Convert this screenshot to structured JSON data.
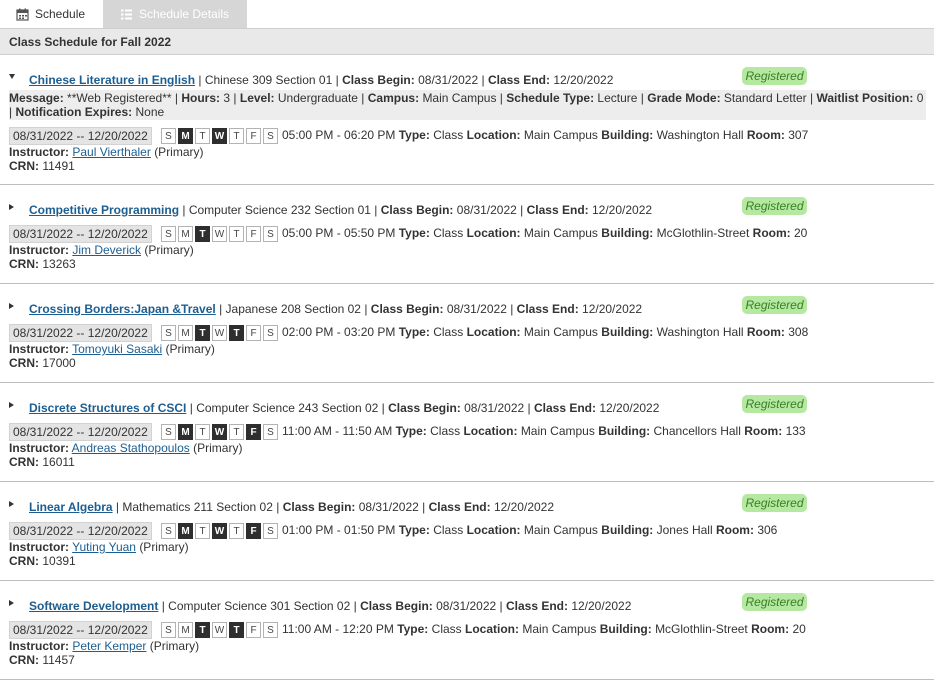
{
  "tabs": [
    {
      "label": "Schedule",
      "icon": "calendar-icon"
    },
    {
      "label": "Schedule Details",
      "icon": "list-icon",
      "active": true
    }
  ],
  "page_title": "Class Schedule for Fall 2022",
  "labels": {
    "class_begin": "Class Begin:",
    "class_end": "Class End:",
    "type": "Type:",
    "location": "Location:",
    "building": "Building:",
    "room": "Room:",
    "instructor": "Instructor:",
    "crn": "CRN:",
    "message": "Message:",
    "hours": "Hours:",
    "level": "Level:",
    "campus": "Campus:",
    "schedule_type": "Schedule Type:",
    "grade_mode": "Grade Mode:",
    "waitlist": "Waitlist Position:",
    "notification": "Notification Expires:"
  },
  "colors": {
    "badge_bg": "#b5e9a2",
    "badge_text": "#3a7d22",
    "link": "#1c5e91",
    "active_day": "#2e2e2e"
  },
  "courses": [
    {
      "title": "Chinese Literature in English",
      "subject": "Chinese 309 Section 01",
      "begin": "08/31/2022",
      "end": "12/20/2022",
      "status": "Registered",
      "expanded": true,
      "details": {
        "message": "**Web Registered**",
        "hours": "3",
        "level": "Undergraduate",
        "campus": "Main Campus",
        "schedule_type": "Lecture",
        "grade_mode": "Standard Letter",
        "waitlist": "0",
        "notification": "None"
      },
      "date_range": "08/31/2022 -- 12/20/2022",
      "days": [
        [
          "S",
          false
        ],
        [
          "M",
          true
        ],
        [
          "T",
          false
        ],
        [
          "W",
          true
        ],
        [
          "T",
          false
        ],
        [
          "F",
          false
        ],
        [
          "S",
          false
        ]
      ],
      "time": "05:00 PM - 06:20 PM",
      "type": "Class",
      "location": "Main Campus",
      "building": "Washington Hall",
      "room": "307",
      "instructor": "Paul Vierthaler",
      "role": "(Primary)",
      "crn": "11491"
    },
    {
      "title": "Competitive Programming",
      "subject": "Computer Science 232 Section 01",
      "begin": "08/31/2022",
      "end": "12/20/2022",
      "status": "Registered",
      "expanded": false,
      "date_range": "08/31/2022 -- 12/20/2022",
      "days": [
        [
          "S",
          false
        ],
        [
          "M",
          false
        ],
        [
          "T",
          true
        ],
        [
          "W",
          false
        ],
        [
          "T",
          false
        ],
        [
          "F",
          false
        ],
        [
          "S",
          false
        ]
      ],
      "time": "05:00 PM - 05:50 PM",
      "type": "Class",
      "location": "Main Campus",
      "building": "McGlothlin-Street",
      "room": "20",
      "instructor": "Jim Deverick",
      "role": "(Primary)",
      "crn": "13263"
    },
    {
      "title": "Crossing Borders:Japan &Travel",
      "subject": "Japanese 208 Section 02",
      "begin": "08/31/2022",
      "end": "12/20/2022",
      "status": "Registered",
      "expanded": false,
      "date_range": "08/31/2022 -- 12/20/2022",
      "days": [
        [
          "S",
          false
        ],
        [
          "M",
          false
        ],
        [
          "T",
          true
        ],
        [
          "W",
          false
        ],
        [
          "T",
          true
        ],
        [
          "F",
          false
        ],
        [
          "S",
          false
        ]
      ],
      "time": "02:00 PM - 03:20 PM",
      "type": "Class",
      "location": "Main Campus",
      "building": "Washington Hall",
      "room": "308",
      "instructor": "Tomoyuki Sasaki",
      "role": "(Primary)",
      "crn": "17000"
    },
    {
      "title": "Discrete Structures of CSCI",
      "subject": "Computer Science 243 Section 02",
      "begin": "08/31/2022",
      "end": "12/20/2022",
      "status": "Registered",
      "expanded": false,
      "date_range": "08/31/2022 -- 12/20/2022",
      "days": [
        [
          "S",
          false
        ],
        [
          "M",
          true
        ],
        [
          "T",
          false
        ],
        [
          "W",
          true
        ],
        [
          "T",
          false
        ],
        [
          "F",
          true
        ],
        [
          "S",
          false
        ]
      ],
      "time": "11:00 AM - 11:50 AM",
      "type": "Class",
      "location": "Main Campus",
      "building": "Chancellors Hall",
      "room": "133",
      "instructor": "Andreas Stathopoulos",
      "role": "(Primary)",
      "crn": "16011"
    },
    {
      "title": "Linear Algebra",
      "subject": "Mathematics 211 Section 02",
      "begin": "08/31/2022",
      "end": "12/20/2022",
      "status": "Registered",
      "expanded": false,
      "date_range": "08/31/2022 -- 12/20/2022",
      "days": [
        [
          "S",
          false
        ],
        [
          "M",
          true
        ],
        [
          "T",
          false
        ],
        [
          "W",
          true
        ],
        [
          "T",
          false
        ],
        [
          "F",
          true
        ],
        [
          "S",
          false
        ]
      ],
      "time": "01:00 PM - 01:50 PM",
      "type": "Class",
      "location": "Main Campus",
      "building": "Jones Hall",
      "room": "306",
      "instructor": "Yuting Yuan",
      "role": "(Primary)",
      "crn": "10391"
    },
    {
      "title": "Software Development",
      "subject": "Computer Science 301 Section 02",
      "begin": "08/31/2022",
      "end": "12/20/2022",
      "status": "Registered",
      "expanded": false,
      "date_range": "08/31/2022 -- 12/20/2022",
      "days": [
        [
          "S",
          false
        ],
        [
          "M",
          false
        ],
        [
          "T",
          true
        ],
        [
          "W",
          false
        ],
        [
          "T",
          true
        ],
        [
          "F",
          false
        ],
        [
          "S",
          false
        ]
      ],
      "time": "11:00 AM - 12:20 PM",
      "type": "Class",
      "location": "Main Campus",
      "building": "McGlothlin-Street",
      "room": "20",
      "instructor": "Peter Kemper",
      "role": "(Primary)",
      "crn": "11457"
    }
  ]
}
